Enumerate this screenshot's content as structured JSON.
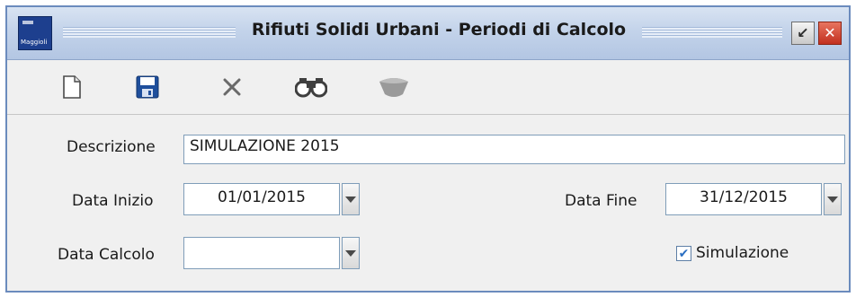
{
  "window": {
    "title": "Rifiuti Solidi Urbani - Periodi di Calcolo",
    "logo_text": "Maggioli",
    "minimize_label": "↙",
    "close_label": "✕"
  },
  "toolbar": {
    "items": [
      {
        "name": "new-document",
        "icon": "page-icon",
        "enabled": true
      },
      {
        "name": "save",
        "icon": "floppy-icon",
        "enabled": true
      },
      {
        "name": "delete",
        "icon": "cross-icon",
        "enabled": true
      },
      {
        "name": "search",
        "icon": "binoculars-icon",
        "enabled": true
      },
      {
        "name": "stop",
        "icon": "dome-icon",
        "enabled": false
      }
    ]
  },
  "form": {
    "descrizione_label": "Descrizione",
    "descrizione_value": "SIMULAZIONE 2015",
    "data_inizio_label": "Data Inizio",
    "data_inizio_value": "01/01/2015",
    "data_fine_label": "Data Fine",
    "data_fine_value": "31/12/2015",
    "data_calcolo_label": "Data Calcolo",
    "data_calcolo_value": "",
    "simulazione_label": "Simulazione",
    "simulazione_checked": true,
    "check_mark": "✔"
  },
  "colors": {
    "titlebar": "#c3d3ea",
    "window_border": "#6b8bbd",
    "field_border": "#7f9db9",
    "close_button": "#c2301f",
    "background": "#f0f0f0"
  }
}
